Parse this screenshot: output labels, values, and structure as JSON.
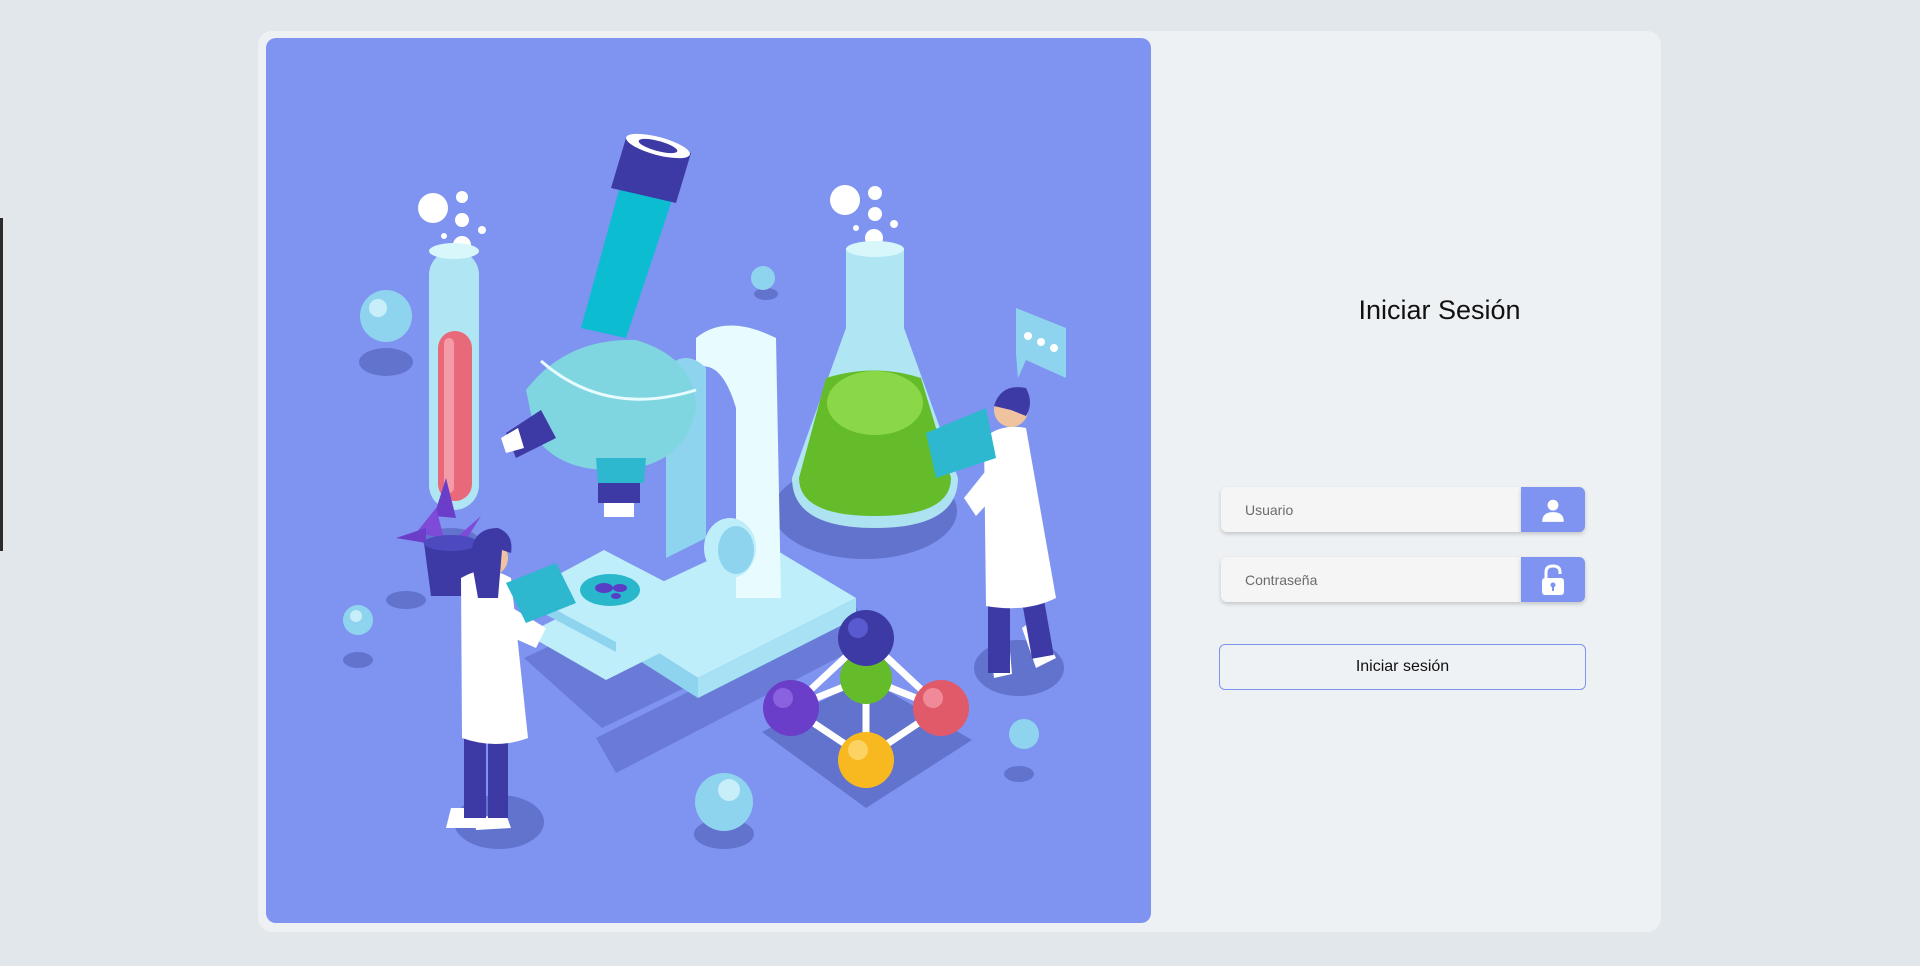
{
  "login": {
    "title": "Iniciar Sesión",
    "username": {
      "placeholder": "Usuario",
      "value": "",
      "icon": "user-icon"
    },
    "password": {
      "placeholder": "Contraseña",
      "value": "",
      "icon": "unlock-icon"
    },
    "submit_label": "Iniciar sesión"
  },
  "colors": {
    "accent": "#7f93f0",
    "page_background": "#e2e7ec",
    "card_background": "#edf1f3"
  },
  "illustration": {
    "icon": "laboratory-scientists-illustration"
  }
}
